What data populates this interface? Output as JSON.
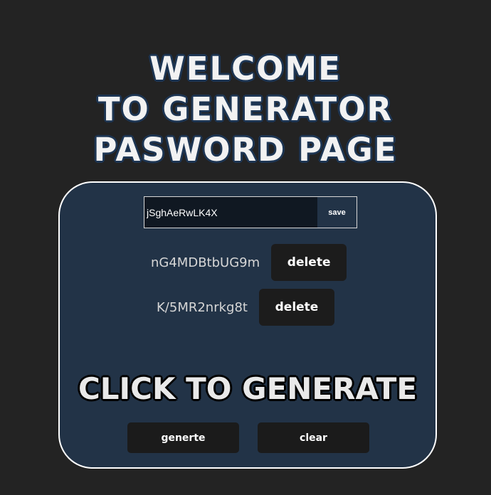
{
  "header": {
    "line1": "WELCOME",
    "line2": "TO GENERATOR",
    "line3": "PASWORD PAGE"
  },
  "input": {
    "value": "jSghAeRwLK4X",
    "save_label": "save"
  },
  "saved_passwords": [
    {
      "text": "nG4MDBtbUG9m",
      "delete_label": "delete"
    },
    {
      "text": "K/5MR2nrkg8t",
      "delete_label": "delete"
    }
  ],
  "generate_heading": "CLICK TO GENERATE",
  "actions": {
    "generate_label": "generte",
    "clear_label": "clear"
  },
  "colors": {
    "background": "#232323",
    "panel": "#223347",
    "button": "#1c1c1c"
  }
}
